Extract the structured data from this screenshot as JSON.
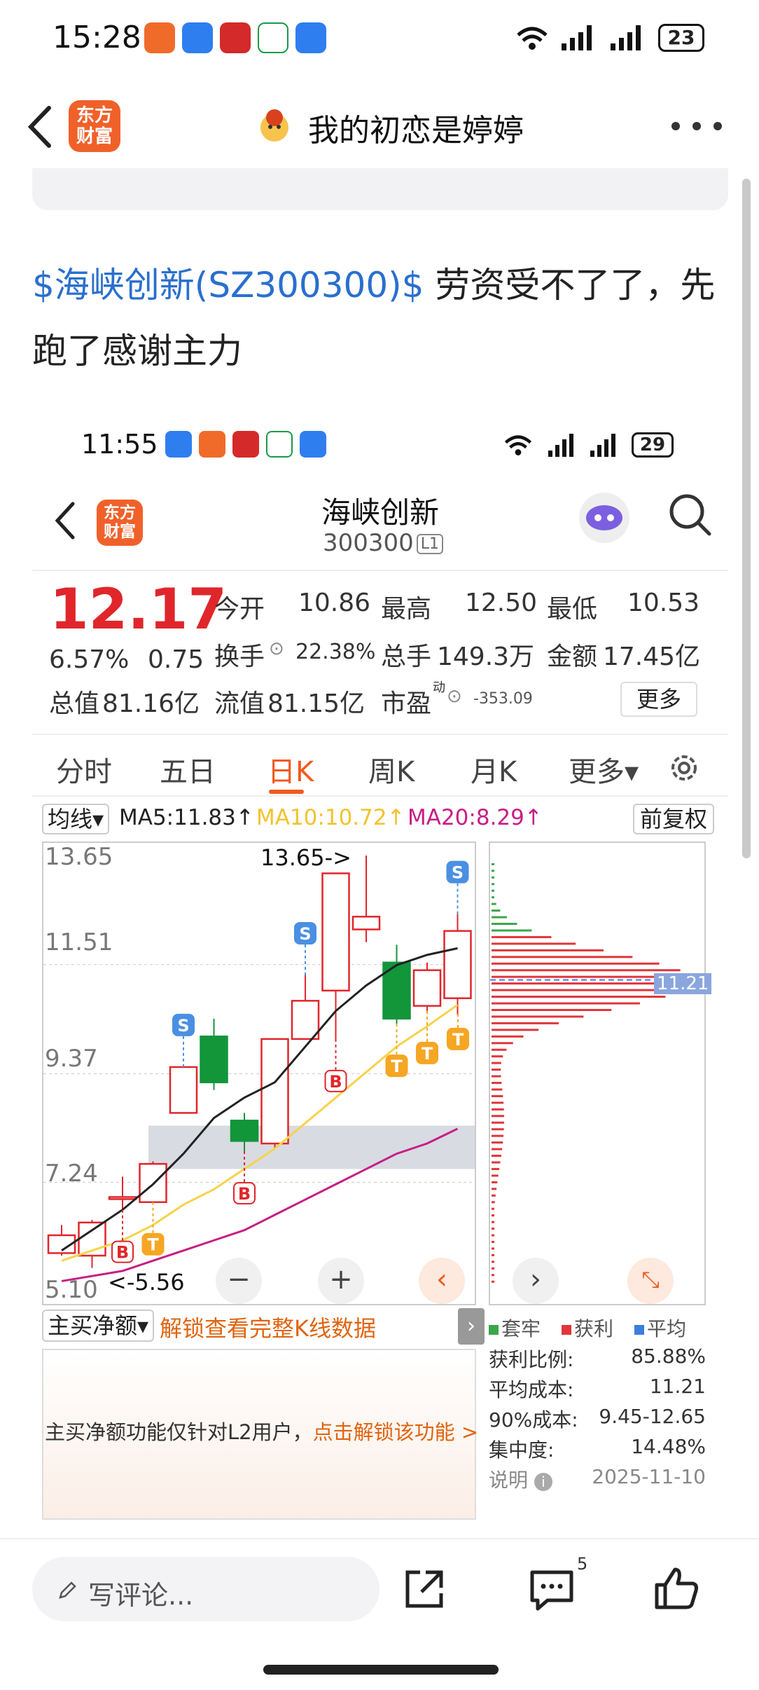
{
  "status_bar": {
    "time": "15:28",
    "battery": "23",
    "network": "6"
  },
  "app_bar": {
    "logo_line1": "东方",
    "logo_line2": "财富",
    "title": "我的初恋是婷婷"
  },
  "post": {
    "stock_tag": "$海峡创新(SZ300300)$",
    "text": " 劳资受不了了，先跑了感谢主力"
  },
  "shot": {
    "status_bar": {
      "time": "11:55",
      "battery": "29"
    },
    "stock": {
      "name": "海峡创新",
      "code": "300300",
      "level": "L1"
    },
    "logo_line1": "东方",
    "logo_line2": "财富",
    "quote": {
      "price": "12.17",
      "change_pct": "6.57%",
      "change": "0.75",
      "open_label": "今开",
      "open": "10.86",
      "high_label": "最高",
      "high": "12.50",
      "low_label": "最低",
      "low": "10.53",
      "turnover_label": "换手",
      "turnover": "22.38%",
      "volume_label": "总手",
      "volume": "149.3万",
      "amount_label": "金额",
      "amount": "17.45亿",
      "mktcap_label": "总值",
      "mktcap": "81.16亿",
      "float_label": "流值",
      "float": "81.15亿",
      "pe_label": "市盈",
      "pe_sup": "动",
      "pe": "-353.09",
      "more": "更多"
    },
    "tabs": [
      "分时",
      "五日",
      "日K",
      "周K",
      "月K",
      "更多▾"
    ],
    "active_tab": 2,
    "ma": {
      "selector": "均线▾",
      "ma5": "MA5:11.83↑",
      "ma10": "MA10:10.72↑",
      "ma20": "MA20:8.29↑",
      "adjust": "前复权"
    },
    "chart": {
      "y_labels": [
        "13.65",
        "11.51",
        "9.37",
        "7.24",
        "5.10"
      ],
      "high_note": "13.65->",
      "low_note": "<-5.56",
      "vp_avg_label": "11.21"
    },
    "chart_data": {
      "type": "candlestick",
      "ylim": [
        5.1,
        13.65
      ],
      "candles": [
        {
          "o": 5.85,
          "c": 6.2,
          "h": 6.4,
          "l": 5.8
        },
        {
          "o": 5.8,
          "c": 6.45,
          "h": 6.5,
          "l": 5.56
        },
        {
          "o": 6.95,
          "c": 6.95,
          "h": 7.35,
          "l": 6.7
        },
        {
          "o": 6.85,
          "c": 7.6,
          "h": 7.65,
          "l": 6.85
        },
        {
          "o": 8.6,
          "c": 9.5,
          "h": 9.5,
          "l": 8.6
        },
        {
          "o": 10.1,
          "c": 9.2,
          "h": 10.45,
          "l": 9.05
        },
        {
          "o": 8.45,
          "c": 8.05,
          "h": 8.6,
          "l": 7.85
        },
        {
          "o": 8.0,
          "c": 10.05,
          "h": 10.05,
          "l": 7.9
        },
        {
          "o": 10.05,
          "c": 10.8,
          "h": 11.3,
          "l": 10.05
        },
        {
          "o": 11.0,
          "c": 13.3,
          "h": 13.3,
          "l": 10.05
        },
        {
          "o": 12.2,
          "c": 12.45,
          "h": 13.65,
          "l": 11.95
        },
        {
          "o": 11.55,
          "c": 10.45,
          "h": 11.9,
          "l": 10.35
        },
        {
          "o": 10.7,
          "c": 11.4,
          "h": 11.55,
          "l": 10.6
        },
        {
          "o": 10.85,
          "c": 12.17,
          "h": 12.5,
          "l": 10.53
        }
      ],
      "ma5": [
        5.9,
        6.3,
        6.7,
        7.2,
        7.8,
        8.5,
        8.9,
        9.2,
        9.9,
        10.6,
        11.1,
        11.5,
        11.7,
        11.83
      ],
      "ma10": [
        5.7,
        5.9,
        6.1,
        6.4,
        6.8,
        7.1,
        7.5,
        7.9,
        8.4,
        8.9,
        9.4,
        9.9,
        10.3,
        10.72
      ],
      "ma20": [
        5.3,
        5.4,
        5.5,
        5.7,
        5.9,
        6.1,
        6.3,
        6.6,
        6.9,
        7.2,
        7.5,
        7.8,
        8.0,
        8.29
      ]
    },
    "signals": [
      {
        "idx": 2,
        "type": "B",
        "kind": "buy"
      },
      {
        "idx": 3,
        "type": "T",
        "kind": "t"
      },
      {
        "idx": 4,
        "type": "S",
        "kind": "sell"
      },
      {
        "idx": 6,
        "type": "B",
        "kind": "buy"
      },
      {
        "idx": 8,
        "type": "S",
        "kind": "sell"
      },
      {
        "idx": 9,
        "type": "B",
        "kind": "buy"
      },
      {
        "idx": 11,
        "type": "T",
        "kind": "t"
      },
      {
        "idx": 12,
        "type": "T",
        "kind": "t"
      },
      {
        "idx": 12,
        "type": "T",
        "kind": "t2"
      },
      {
        "idx": 13,
        "type": "S",
        "kind": "sell"
      }
    ],
    "l2": {
      "selector": "主买净额▾",
      "unlock": "解锁查看完整K线数据",
      "msg": "主买净额功能仅针对L2用户，",
      "msg_link": "点击解锁该功能 >"
    },
    "vp_legend": {
      "stable": "套牢",
      "profit": "获利",
      "avg": "平均"
    },
    "vp_stats": {
      "profit_ratio_label": "获利比例:",
      "profit_ratio": "85.88%",
      "avg_cost_label": "平均成本:",
      "avg_cost": "11.21",
      "cost90_label": "90%成本:",
      "cost90": "9.45-12.65",
      "concentration_label": "集中度:",
      "concentration": "14.48%",
      "note_label": "说明",
      "date": "2025-11-10"
    },
    "colors": {
      "up": "#e0262b",
      "down": "#13953a",
      "ma5": "#222222",
      "ma10": "#f7d34a",
      "ma20": "#c71e86"
    }
  },
  "bottom_bar": {
    "comment_placeholder": "写评论...",
    "comment_count": "5"
  }
}
